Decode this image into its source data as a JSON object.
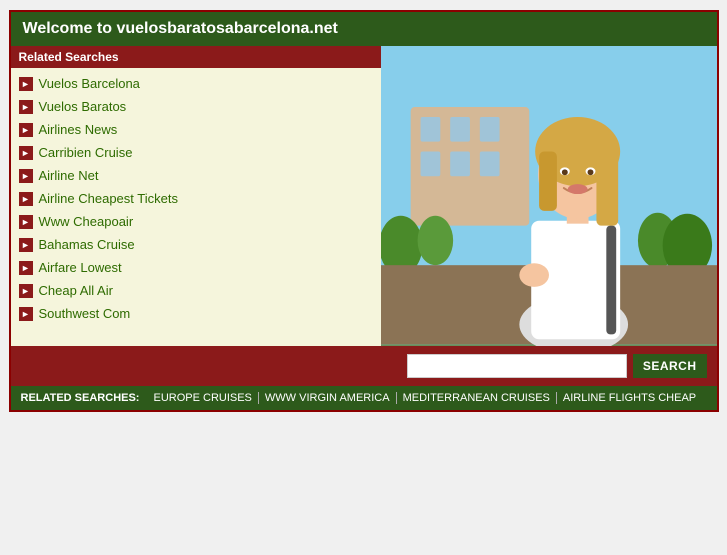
{
  "header": {
    "title": "Welcome to vuelosbaratosabarcelona.net"
  },
  "sidebar": {
    "related_searches_label": "Related Searches",
    "links": [
      {
        "label": "Vuelos Barcelona"
      },
      {
        "label": "Vuelos Baratos"
      },
      {
        "label": "Airlines News"
      },
      {
        "label": "Carribien Cruise"
      },
      {
        "label": "Airline Net"
      },
      {
        "label": "Airline Cheapest Tickets"
      },
      {
        "label": "Www Cheapoair"
      },
      {
        "label": "Bahamas Cruise"
      },
      {
        "label": "Airfare Lowest"
      },
      {
        "label": "Cheap All Air"
      },
      {
        "label": "Southwest Com"
      }
    ]
  },
  "search": {
    "placeholder": "",
    "button_label": "SEARCH"
  },
  "footer": {
    "label": "RELATED SEARCHES:",
    "links": [
      {
        "label": "EUROPE CRUISES"
      },
      {
        "label": "WWW VIRGIN AMERICA"
      },
      {
        "label": "MEDITERRANEAN CRUISES"
      },
      {
        "label": "AIRLINE FLIGHTS CHEAP"
      }
    ]
  }
}
